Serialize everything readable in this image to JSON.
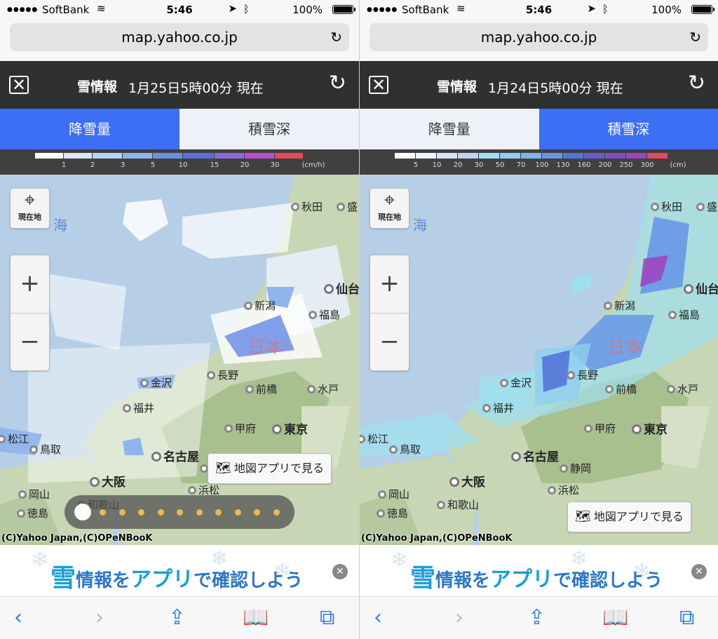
{
  "panels": [
    {
      "status": {
        "dots": "●●●●●",
        "carrier": "SoftBank",
        "time": "5:46",
        "battery": "100%"
      },
      "url": "map.yahoo.co.jp",
      "header": {
        "title": "雪情報",
        "date": "1月25日5時00分 現在"
      },
      "tabs": [
        {
          "label": "降雪量",
          "active": true
        },
        {
          "label": "積雪深",
          "active": false
        }
      ],
      "legend": {
        "labels": [
          "1",
          "2",
          "3",
          "5",
          "10",
          "15",
          "20",
          "30",
          "(cm/h)"
        ],
        "colors": [
          "#ffffff",
          "#dfe6f6",
          "#b8d2f2",
          "#8fb3ef",
          "#6f8ee6",
          "#5a6fd9",
          "#8c6ad8",
          "#b74fd0",
          "#e34a5a"
        ]
      },
      "map": {
        "location_label": "現在地",
        "zoom_in": "+",
        "zoom_out": "−",
        "app_button": "地図アプリで見る",
        "sea": "海",
        "country": "日本",
        "credit": "(C)Yahoo Japan,(C)OPeNBooK",
        "cities": [
          {
            "name": "秋田"
          },
          {
            "name": "盛"
          },
          {
            "name": "仙台"
          },
          {
            "name": "新潟"
          },
          {
            "name": "福島"
          },
          {
            "name": "長野"
          },
          {
            "name": "金沢"
          },
          {
            "name": "前橋"
          },
          {
            "name": "水戸"
          },
          {
            "name": "福井"
          },
          {
            "name": "甲府"
          },
          {
            "name": "東京"
          },
          {
            "name": "松江"
          },
          {
            "name": "鳥取"
          },
          {
            "name": "名古屋"
          },
          {
            "name": "静岡"
          },
          {
            "name": "大阪"
          },
          {
            "name": "浜松"
          },
          {
            "name": "岡山"
          },
          {
            "name": "和歌山"
          },
          {
            "name": "徳島"
          }
        ],
        "timeline": true
      },
      "banner": {
        "big": "雪",
        "mid": "情報を",
        "app": "アプリ",
        "tail": "で確認しよう"
      }
    },
    {
      "status": {
        "dots": "●●●●●",
        "carrier": "SoftBank",
        "time": "5:46",
        "battery": "100%"
      },
      "url": "map.yahoo.co.jp",
      "header": {
        "title": "雪情報",
        "date": "1月24日5時00分 現在"
      },
      "tabs": [
        {
          "label": "降雪量",
          "active": false
        },
        {
          "label": "積雪深",
          "active": true
        }
      ],
      "legend": {
        "labels": [
          "5",
          "10",
          "20",
          "30",
          "50",
          "70",
          "100",
          "130",
          "160",
          "200",
          "250",
          "300",
          "(cm)"
        ],
        "colors": [
          "#ffffff",
          "#eef2fb",
          "#d9e3f6",
          "#c3d4f3",
          "#9fe0f0",
          "#8fd0ee",
          "#7bb8ec",
          "#6797e6",
          "#5474d9",
          "#6a5ad0",
          "#7a4fc8",
          "#9a46c0",
          "#e34a5a"
        ]
      },
      "map": {
        "location_label": "現在地",
        "zoom_in": "+",
        "zoom_out": "−",
        "app_button": "地図アプリで見る",
        "sea": "海",
        "country": "日本",
        "credit": "(C)Yahoo Japan,(C)OPeNBooK",
        "cities": [
          {
            "name": "秋田"
          },
          {
            "name": "盛"
          },
          {
            "name": "仙台"
          },
          {
            "name": "新潟"
          },
          {
            "name": "福島"
          },
          {
            "name": "長野"
          },
          {
            "name": "金沢"
          },
          {
            "name": "前橋"
          },
          {
            "name": "水戸"
          },
          {
            "name": "福井"
          },
          {
            "name": "甲府"
          },
          {
            "name": "東京"
          },
          {
            "name": "松江"
          },
          {
            "name": "鳥取"
          },
          {
            "name": "名古屋"
          },
          {
            "name": "静岡"
          },
          {
            "name": "大阪"
          },
          {
            "name": "浜松"
          },
          {
            "name": "岡山"
          },
          {
            "name": "和歌山"
          },
          {
            "name": "徳島"
          }
        ],
        "timeline": false
      },
      "banner": {
        "big": "雪",
        "mid": "情報を",
        "app": "アプリ",
        "tail": "で確認しよう"
      }
    }
  ]
}
